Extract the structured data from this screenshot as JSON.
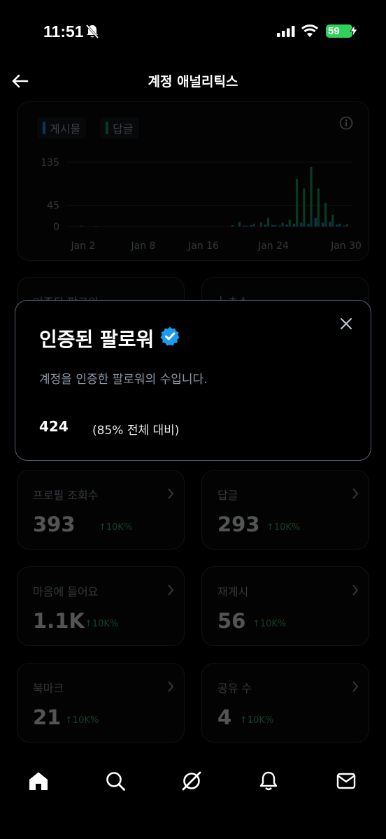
{
  "status_bar": {
    "time": "11:51",
    "battery": "59"
  },
  "header": {
    "title": "계정 애널리틱스"
  },
  "chart_data": {
    "type": "bar",
    "legend": [
      "게시물",
      "답글"
    ],
    "y_ticks": [
      "135",
      "45",
      "0"
    ],
    "x_ticks": [
      "Jan 2",
      "Jan 8",
      "Jan 16",
      "Jan 24",
      "Jan 30"
    ],
    "ylim": [
      0,
      145
    ],
    "series": [
      {
        "name": "게시물",
        "color": "#1d9bf0",
        "values": [
          0,
          0,
          0,
          0,
          0,
          0,
          0,
          0,
          0,
          0,
          0,
          0,
          0,
          0,
          0,
          0,
          0,
          0,
          0,
          0,
          0,
          0,
          0,
          0,
          2,
          3,
          0,
          4,
          3,
          2,
          4,
          6,
          8,
          6,
          18,
          8,
          10,
          4,
          2
        ]
      },
      {
        "name": "답글",
        "color": "#17a05d",
        "values": [
          0,
          2,
          0,
          1,
          0,
          0,
          0,
          0,
          0,
          0,
          0,
          0,
          0,
          0,
          0,
          0,
          0,
          0,
          0,
          0,
          0,
          0,
          3,
          10,
          2,
          6,
          9,
          18,
          3,
          8,
          14,
          100,
          80,
          125,
          80,
          50,
          25,
          6,
          5
        ]
      }
    ]
  },
  "top_cards": [
    {
      "label": "인증된 팔로워"
    },
    {
      "label": "└ 추수"
    }
  ],
  "stat_cards": [
    {
      "label": "프로필 조회수",
      "value": "393",
      "change": "↑10K%"
    },
    {
      "label": "답글",
      "value": "293",
      "change": "↑10K%"
    },
    {
      "label": "마음에 들어요",
      "value": "1.1K",
      "change": "↑10K%"
    },
    {
      "label": "재게시",
      "value": "56",
      "change": "↑10K%"
    },
    {
      "label": "북마크",
      "value": "21",
      "change": "↑10K%"
    },
    {
      "label": "공유 수",
      "value": "4",
      "change": "↑10K%"
    }
  ],
  "modal": {
    "title": "인증된 팔로워",
    "description": "계정을 인증한 팔로워의 수입니다.",
    "count": "424",
    "percent_text": "(85% 전체 대비)"
  },
  "icons": {
    "back": "arrow-left-icon",
    "info": "info-icon",
    "close": "close-icon",
    "verified": "verified-badge-icon",
    "nav": [
      "home-icon",
      "search-icon",
      "grok-icon",
      "bell-icon",
      "mail-icon"
    ]
  },
  "colors": {
    "accent": "#1d9bf0",
    "positive": "#17a05d",
    "background": "#000000"
  }
}
